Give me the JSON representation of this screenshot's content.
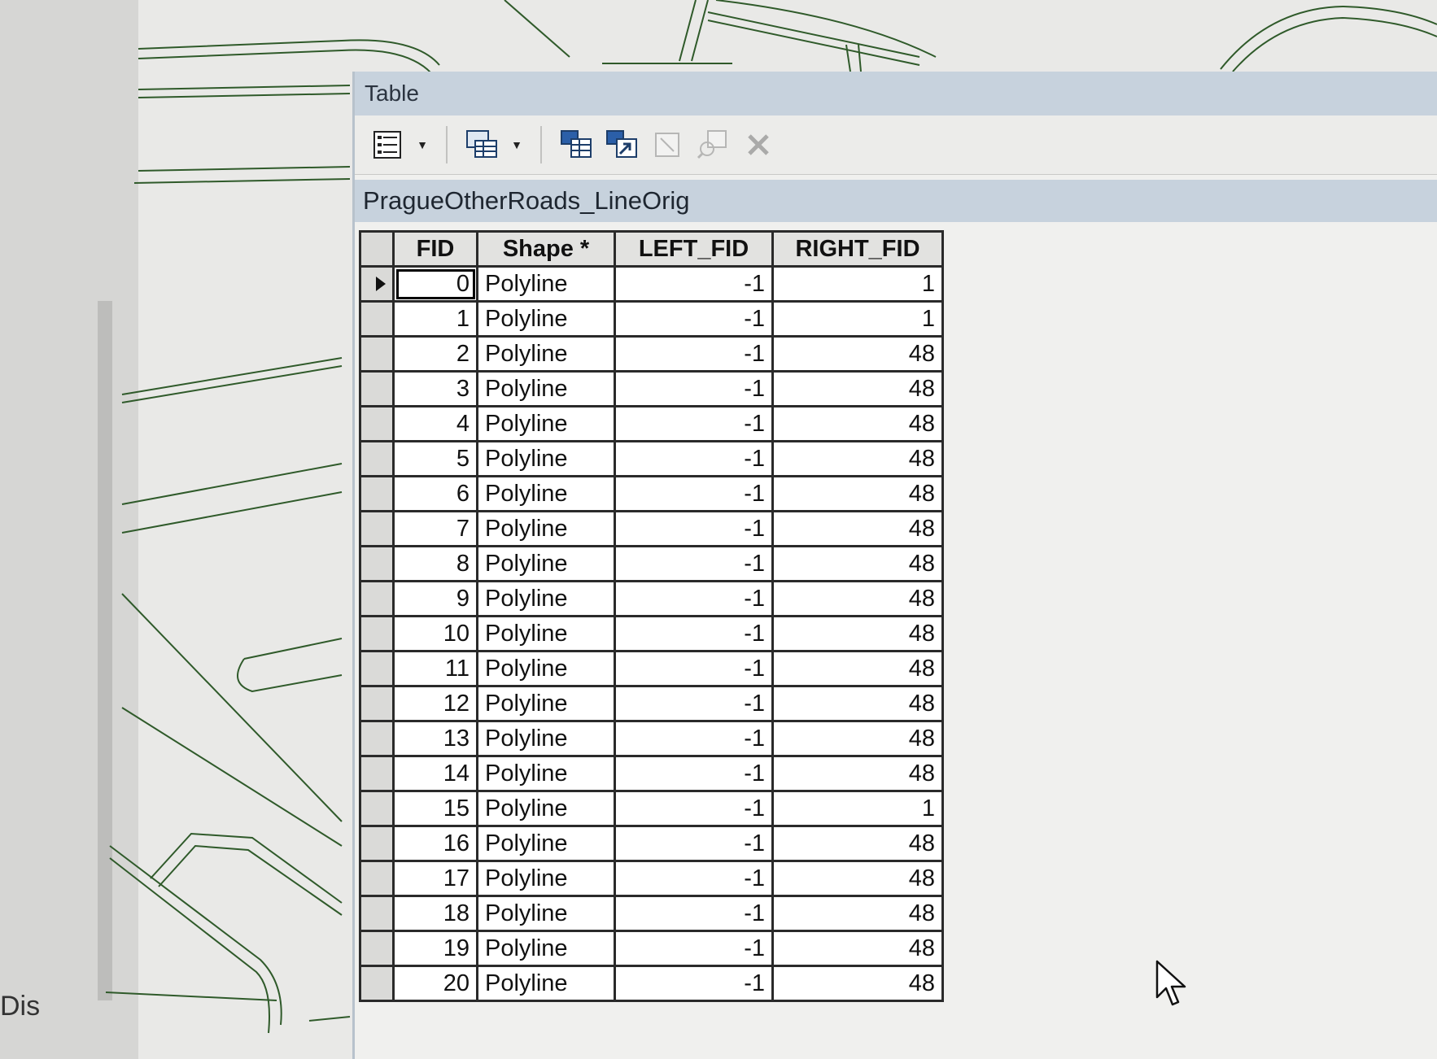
{
  "map": {
    "side_label": "Dis"
  },
  "window": {
    "title": "Table",
    "toolbar": {
      "buttons": [
        {
          "name": "table-options-icon",
          "enabled": true,
          "dropdown": true
        },
        {
          "name": "related-tables-icon",
          "enabled": true,
          "dropdown": true
        },
        {
          "name": "select-by-attributes-icon",
          "enabled": true,
          "dropdown": false
        },
        {
          "name": "switch-selection-icon",
          "enabled": true,
          "dropdown": false
        },
        {
          "name": "clear-selection-icon",
          "enabled": false,
          "dropdown": false
        },
        {
          "name": "zoom-to-selected-icon",
          "enabled": false,
          "dropdown": false
        },
        {
          "name": "delete-selected-icon",
          "enabled": false,
          "dropdown": false
        }
      ]
    },
    "tab_title": "PragueOtherRoads_LineOrig"
  },
  "table": {
    "columns": [
      "FID",
      "Shape *",
      "LEFT_FID",
      "RIGHT_FID"
    ],
    "current_row": 0,
    "rows": [
      {
        "fid": "0",
        "shape": "Polyline",
        "left_fid": "-1",
        "right_fid": "1"
      },
      {
        "fid": "1",
        "shape": "Polyline",
        "left_fid": "-1",
        "right_fid": "1"
      },
      {
        "fid": "2",
        "shape": "Polyline",
        "left_fid": "-1",
        "right_fid": "48"
      },
      {
        "fid": "3",
        "shape": "Polyline",
        "left_fid": "-1",
        "right_fid": "48"
      },
      {
        "fid": "4",
        "shape": "Polyline",
        "left_fid": "-1",
        "right_fid": "48"
      },
      {
        "fid": "5",
        "shape": "Polyline",
        "left_fid": "-1",
        "right_fid": "48"
      },
      {
        "fid": "6",
        "shape": "Polyline",
        "left_fid": "-1",
        "right_fid": "48"
      },
      {
        "fid": "7",
        "shape": "Polyline",
        "left_fid": "-1",
        "right_fid": "48"
      },
      {
        "fid": "8",
        "shape": "Polyline",
        "left_fid": "-1",
        "right_fid": "48"
      },
      {
        "fid": "9",
        "shape": "Polyline",
        "left_fid": "-1",
        "right_fid": "48"
      },
      {
        "fid": "10",
        "shape": "Polyline",
        "left_fid": "-1",
        "right_fid": "48"
      },
      {
        "fid": "11",
        "shape": "Polyline",
        "left_fid": "-1",
        "right_fid": "48"
      },
      {
        "fid": "12",
        "shape": "Polyline",
        "left_fid": "-1",
        "right_fid": "48"
      },
      {
        "fid": "13",
        "shape": "Polyline",
        "left_fid": "-1",
        "right_fid": "48"
      },
      {
        "fid": "14",
        "shape": "Polyline",
        "left_fid": "-1",
        "right_fid": "48"
      },
      {
        "fid": "15",
        "shape": "Polyline",
        "left_fid": "-1",
        "right_fid": "1"
      },
      {
        "fid": "16",
        "shape": "Polyline",
        "left_fid": "-1",
        "right_fid": "48"
      },
      {
        "fid": "17",
        "shape": "Polyline",
        "left_fid": "-1",
        "right_fid": "48"
      },
      {
        "fid": "18",
        "shape": "Polyline",
        "left_fid": "-1",
        "right_fid": "48"
      },
      {
        "fid": "19",
        "shape": "Polyline",
        "left_fid": "-1",
        "right_fid": "48"
      },
      {
        "fid": "20",
        "shape": "Polyline",
        "left_fid": "-1",
        "right_fid": "48"
      }
    ]
  }
}
